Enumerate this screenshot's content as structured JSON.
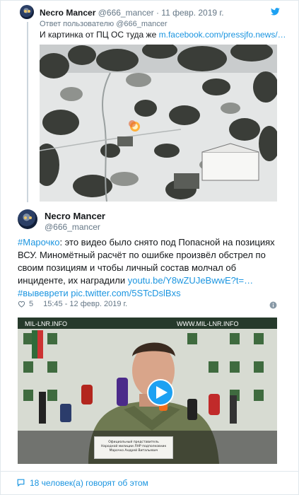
{
  "reply_tweet": {
    "author_name": "Necro Mancer",
    "author_handle": "@666_mancer",
    "separator": "·",
    "date": "11 февр. 2019 г.",
    "reply_prefix": "Ответ пользователю",
    "reply_handle": "@666_mancer",
    "text": "И картинка от ПЦ ОС туда же",
    "link": "m.facebook.com/pressjfo.news/…"
  },
  "main_tweet": {
    "author_name": "Necro Mancer",
    "author_handle": "@666_mancer",
    "hashtag1": "#Марочко",
    "text_body": ": это видео было снято под Попасной на позициях ВСУ. Миномётный расчёт по ошибке произвёл обстрел по своим позициям и чтобы личный состав молчал об инциденте, их наградили",
    "link1": "youtu.be/Y8wZUJeBwwE?t=…",
    "hashtag2": "#вывеврети",
    "link2": "pic.twitter.com/5STcDslBxs",
    "likes": "5",
    "timestamp": "15:45 - 12 февр. 2019 г.",
    "video": {
      "banner_text_left": "MIL-LNR.INFO",
      "banner_text_right": "WWW.MIL-LNR.INFO",
      "plate_line1": "Официальный представитель",
      "plate_line2": "Народной милиции ЛНР подполковник",
      "plate_line3": "Марочко Андрей Витальевич"
    }
  },
  "footer": {
    "talking": "18 человек(а) говорят об этом"
  }
}
